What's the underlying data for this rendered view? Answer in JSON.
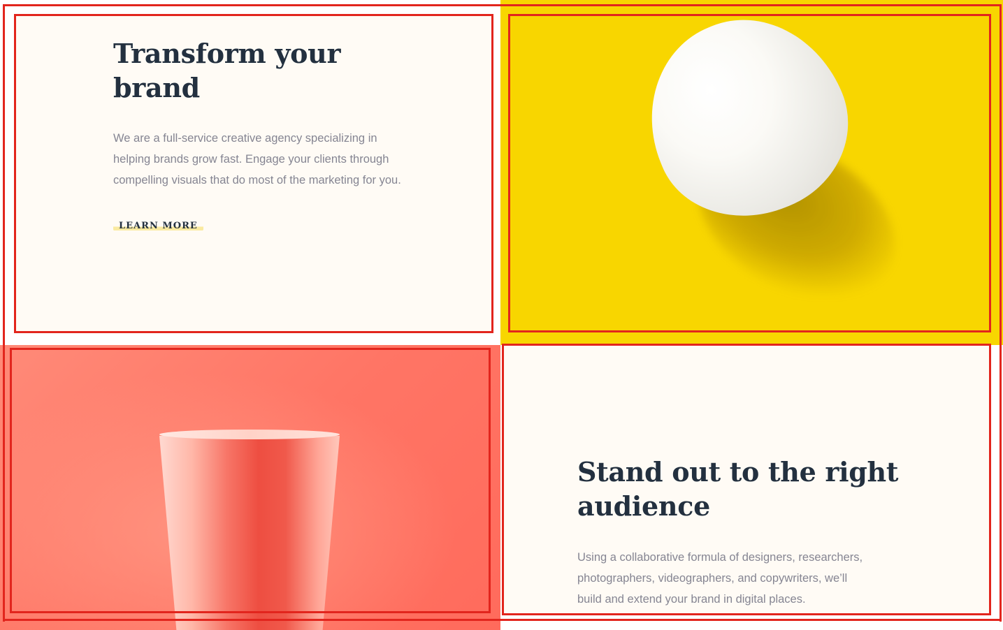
{
  "section_one": {
    "heading_line1": "Transform your",
    "heading_line2": "brand",
    "paragraph_lines": [
      "We are a full-service creative agency specializing in",
      "helping brands grow fast. Engage your clients through",
      "compelling visuals that do most of the marketing for you."
    ],
    "cta_label": "LEARN MORE"
  },
  "section_two": {
    "heading_line1": "Stand out to the right",
    "heading_line2": "audience",
    "paragraph_lines": [
      "Using a collaborative formula of designers, researchers,",
      "photographers, videographers, and copywriters, we’ll",
      "build and extend your brand in digital places."
    ]
  },
  "images": {
    "egg": "egg-on-yellow-image",
    "cup": "pink-cup-image"
  },
  "colors": {
    "heading": "#23303f",
    "body_text": "#858592",
    "cream_background": "#fffbf5",
    "yellow": "#f8d600",
    "coral": "#ff7a6a",
    "cta_highlight": "#faeaa0",
    "annotation_outline": "#e2251d"
  }
}
